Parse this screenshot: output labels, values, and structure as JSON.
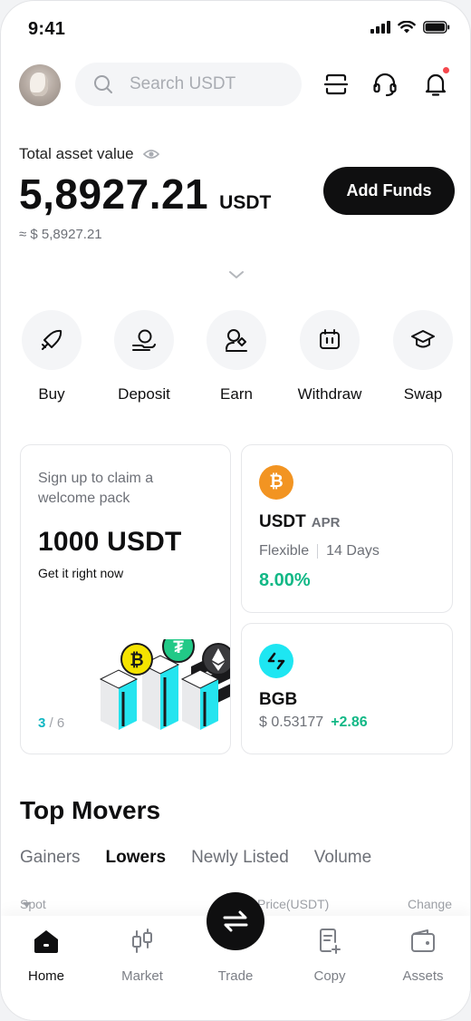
{
  "status_bar": {
    "time": "9:41"
  },
  "header": {
    "search_placeholder": "Search USDT",
    "icons": [
      "scan-icon",
      "headset-icon",
      "bell-icon"
    ],
    "has_notification": true
  },
  "assets": {
    "label": "Total asset value",
    "value": "5,8927.21",
    "unit": "USDT",
    "approx": "≈ $ 5,8927.21",
    "add_funds_label": "Add Funds"
  },
  "actions": [
    {
      "label": "Buy",
      "icon": "rocket-icon"
    },
    {
      "label": "Deposit",
      "icon": "deposit-hand-icon"
    },
    {
      "label": "Earn",
      "icon": "earn-icon"
    },
    {
      "label": "Withdraw",
      "icon": "withdraw-icon"
    },
    {
      "label": "Swap",
      "icon": "graduation-cap-icon"
    }
  ],
  "promo": {
    "subtitle": "Sign up to claim a welcome pack",
    "amount": "1000 USDT",
    "cta": "Get it right now",
    "page_current": "3",
    "page_total": "/ 6"
  },
  "earn_card": {
    "coin_symbol": "₿",
    "name": "USDT",
    "tag": "APR",
    "term_1": "Flexible",
    "term_2": "14 Days",
    "rate": "8.00%"
  },
  "bgb_card": {
    "name": "BGB",
    "price": "$ 0.53177",
    "change": "+2.86"
  },
  "top_movers": {
    "title": "Top Movers",
    "tabs": [
      "Gainers",
      "Lowers",
      "Newly Listed",
      "Volume"
    ],
    "active_tab": "Lowers",
    "columns": {
      "market": "Spot",
      "price": "Price(USDT)",
      "change": "Change"
    }
  },
  "bottom_nav": [
    {
      "label": "Home",
      "icon": "home-icon",
      "active": true
    },
    {
      "label": "Market",
      "icon": "candlestick-icon",
      "active": false
    },
    {
      "label": "Trade",
      "icon": "swap-arrows-icon",
      "active": false
    },
    {
      "label": "Copy",
      "icon": "copy-doc-icon",
      "active": false
    },
    {
      "label": "Assets",
      "icon": "wallet-icon",
      "active": false
    }
  ],
  "colors": {
    "accent_green": "#12b886",
    "accent_cyan": "#10b6c2",
    "dark": "#0f0f10",
    "btc_orange": "#f29422",
    "notification_red": "#f5484d"
  }
}
